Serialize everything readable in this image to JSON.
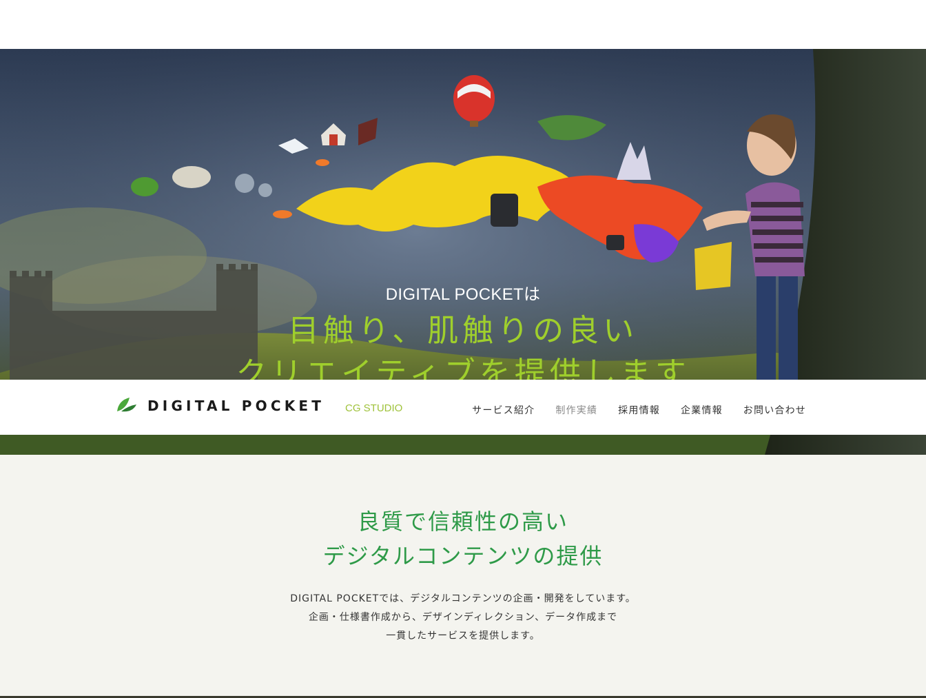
{
  "hero": {
    "intro": "DIGITAL POCKETは",
    "headline_line1": "目触り、肌触りの良い",
    "headline_line2": "クリエイティブを提供します"
  },
  "header": {
    "logo_text": "DIGITAL POCKET",
    "tagline": "CG STUDIO",
    "nav": [
      {
        "label": "サービス紹介",
        "active": false
      },
      {
        "label": "制作実績",
        "active": true
      },
      {
        "label": "採用情報",
        "active": false
      },
      {
        "label": "企業情報",
        "active": false
      },
      {
        "label": "お問い合わせ",
        "active": false
      }
    ]
  },
  "intro_section": {
    "title_line1": "良質で信頼性の高い",
    "title_line2": "デジタルコンテンツの提供",
    "body_line1": "DIGITAL POCKETでは、デジタルコンテンツの企画・開発をしています。",
    "body_line2": "企画・仕様書作成から、デザインディレクション、データ作成まで",
    "body_line3": "一貫したサービスを提供します。"
  },
  "colors": {
    "accent_green": "#2e9a48",
    "headline_green": "#9fcf2c",
    "tagline_green": "#9fc23a",
    "section_bg": "#f4f4ef",
    "nav_active": "#8a8a8a"
  },
  "icons": {
    "logo_mark": "leaf-logo-icon"
  }
}
